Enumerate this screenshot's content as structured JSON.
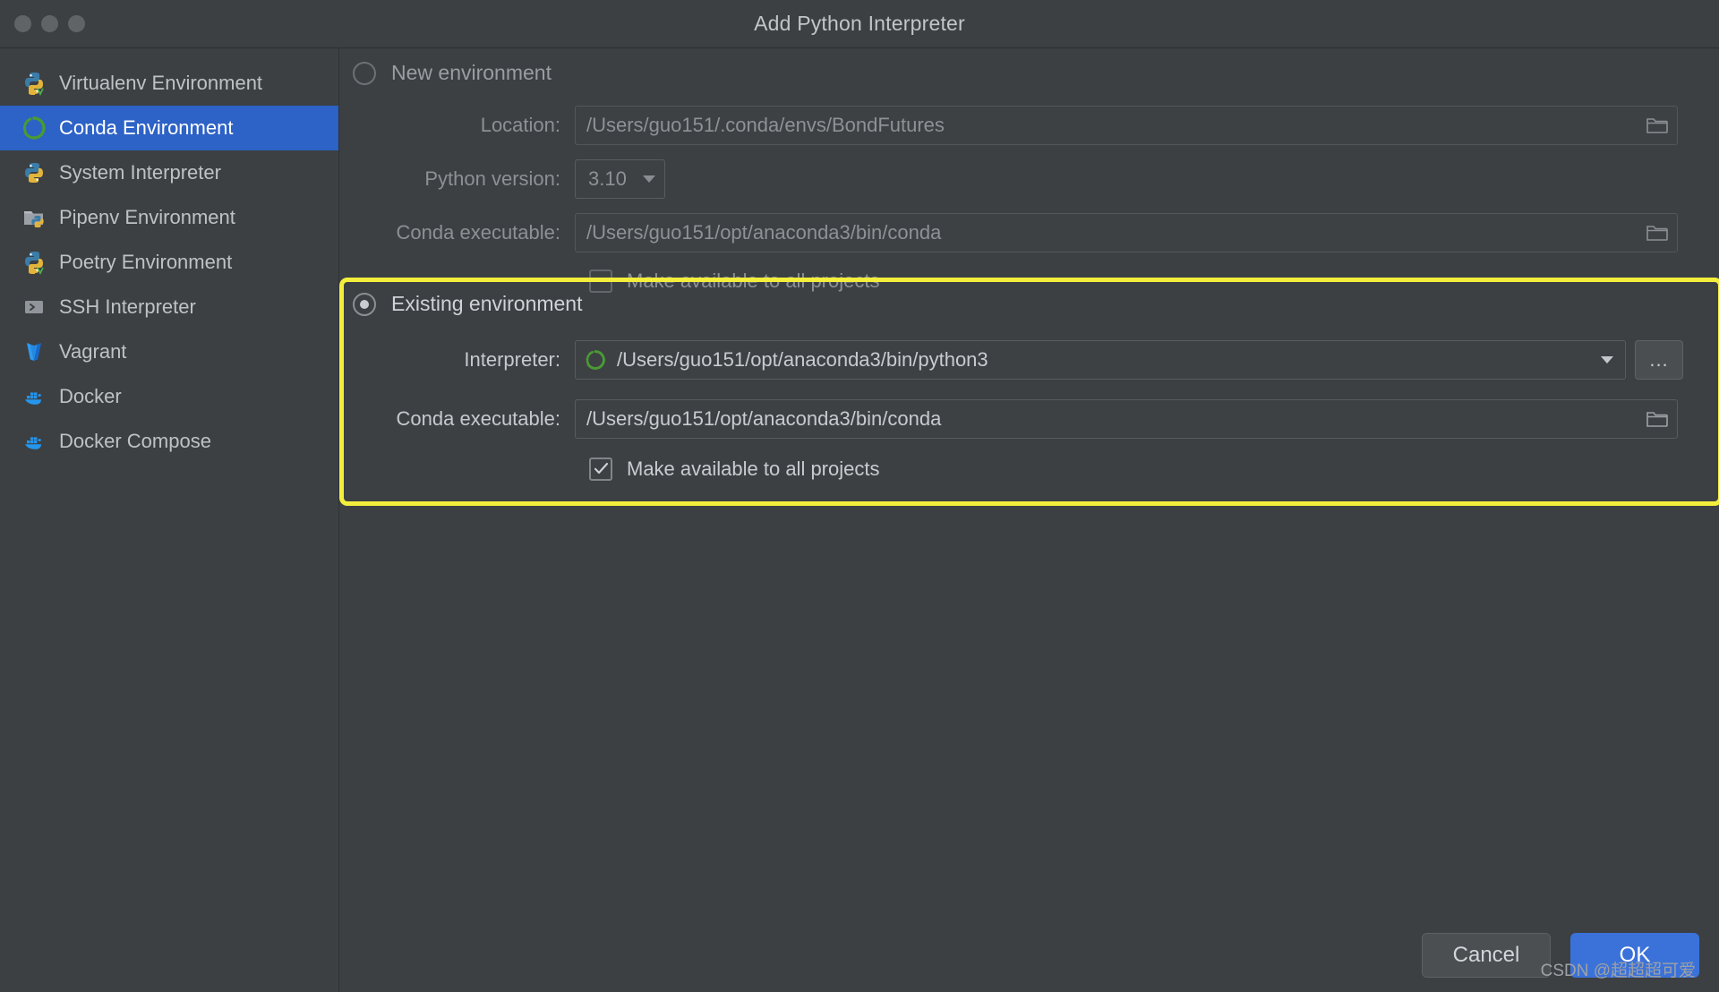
{
  "window": {
    "title": "Add Python Interpreter",
    "traffic_lights": [
      "close",
      "minimize",
      "zoom"
    ]
  },
  "sidebar": {
    "items": [
      {
        "label": "Virtualenv Environment",
        "icon": "python-virtualenv-icon",
        "selected": false
      },
      {
        "label": "Conda Environment",
        "icon": "conda-icon",
        "selected": true
      },
      {
        "label": "System Interpreter",
        "icon": "python-icon",
        "selected": false
      },
      {
        "label": "Pipenv Environment",
        "icon": "pipenv-folder-python-icon",
        "selected": false
      },
      {
        "label": "Poetry Environment",
        "icon": "python-poetry-icon",
        "selected": false
      },
      {
        "label": "SSH Interpreter",
        "icon": "ssh-terminal-icon",
        "selected": false
      },
      {
        "label": "Vagrant",
        "icon": "vagrant-icon",
        "selected": false
      },
      {
        "label": "Docker",
        "icon": "docker-icon",
        "selected": false
      },
      {
        "label": "Docker Compose",
        "icon": "docker-compose-icon",
        "selected": false
      }
    ]
  },
  "new_environment": {
    "radio_label": "New environment",
    "selected": false,
    "enabled": false,
    "location": {
      "label": "Location:",
      "value": "/Users/guo151/.conda/envs/BondFutures",
      "browse_icon": "folder-icon"
    },
    "python_version": {
      "label": "Python version:",
      "value": "3.10",
      "caret_icon": "chevron-down-icon"
    },
    "conda_executable": {
      "label": "Conda executable:",
      "value": "/Users/guo151/opt/anaconda3/bin/conda",
      "browse_icon": "folder-icon"
    },
    "make_available": {
      "label": "Make available to all projects",
      "checked": false
    }
  },
  "existing_environment": {
    "radio_label": "Existing environment",
    "selected": true,
    "enabled": true,
    "highlight_color": "#f3ee3c",
    "interpreter": {
      "label": "Interpreter:",
      "value": "/Users/guo151/opt/anaconda3/bin/python3",
      "value_icon": "conda-icon",
      "caret_icon": "chevron-down-icon",
      "more_button_label": "..."
    },
    "conda_executable": {
      "label": "Conda executable:",
      "value": "/Users/guo151/opt/anaconda3/bin/conda",
      "browse_icon": "folder-icon"
    },
    "make_available": {
      "label": "Make available to all projects",
      "checked": true
    }
  },
  "footer": {
    "cancel_label": "Cancel",
    "ok_label": "OK",
    "accent_color": "#3b72d9"
  },
  "watermark": "CSDN @超超超可爱"
}
